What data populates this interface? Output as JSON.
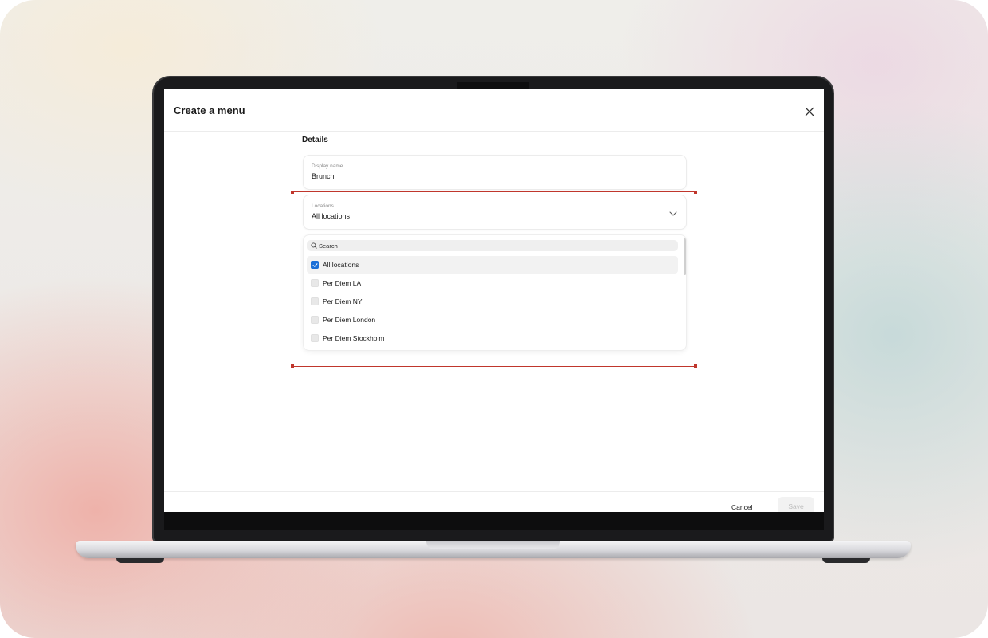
{
  "dialog": {
    "title": "Create a menu",
    "section_label": "Details"
  },
  "display_name": {
    "label": "Display name",
    "value": "Brunch"
  },
  "locations": {
    "label": "Locations",
    "value": "All locations",
    "search_placeholder": "Search",
    "options": [
      {
        "label": "All locations",
        "checked": true
      },
      {
        "label": "Per Diem LA",
        "checked": false
      },
      {
        "label": "Per Diem NY",
        "checked": false
      },
      {
        "label": "Per Diem London",
        "checked": false
      },
      {
        "label": "Per Diem Stockholm",
        "checked": false
      }
    ]
  },
  "footer": {
    "cancel_label": "Cancel",
    "save_label": "Save"
  },
  "colors": {
    "accent": "#1a6fd8",
    "selection_frame": "#c0362c"
  }
}
